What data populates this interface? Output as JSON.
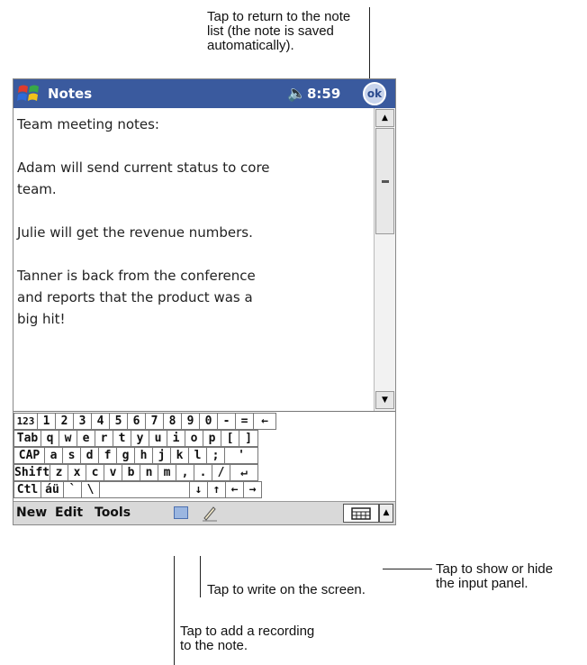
{
  "callouts": {
    "top": [
      "Tap to return to the note",
      "list (the note is saved",
      "automatically)."
    ],
    "input_panel": [
      "Tap to show or hide",
      "the input panel."
    ],
    "write": [
      "Tap to write on the screen."
    ],
    "recording": [
      "Tap to add a recording",
      "to the note."
    ]
  },
  "titlebar": {
    "app_title": "Notes",
    "time": "8:59",
    "ok_label": "ok"
  },
  "note": {
    "paragraphs": [
      [
        "Team meeting notes:"
      ],
      [
        "Adam will send current status to core",
        "team."
      ],
      [
        "Julie will get the revenue numbers."
      ],
      [
        "Tanner is back from the conference",
        "and reports that the product was a",
        "big hit!"
      ]
    ]
  },
  "keyboard": {
    "rows": [
      [
        "123",
        "1",
        "2",
        "3",
        "4",
        "5",
        "6",
        "7",
        "8",
        "9",
        "0",
        "-",
        "=",
        "←"
      ],
      [
        "Tab",
        "q",
        "w",
        "e",
        "r",
        "t",
        "y",
        "u",
        "i",
        "o",
        "p",
        "[",
        "]"
      ],
      [
        "CAP",
        "a",
        "s",
        "d",
        "f",
        "g",
        "h",
        "j",
        "k",
        "l",
        ";",
        "'"
      ],
      [
        "Shift",
        "z",
        "x",
        "c",
        "v",
        "b",
        "n",
        "m",
        ",",
        ".",
        "/",
        "↵"
      ],
      [
        "Ctl",
        "áü",
        "`",
        "\\",
        "",
        "↓",
        "↑",
        "←",
        "→"
      ]
    ]
  },
  "command_bar": {
    "menu_new": "New",
    "menu_edit": "Edit",
    "menu_tools": "Tools"
  }
}
